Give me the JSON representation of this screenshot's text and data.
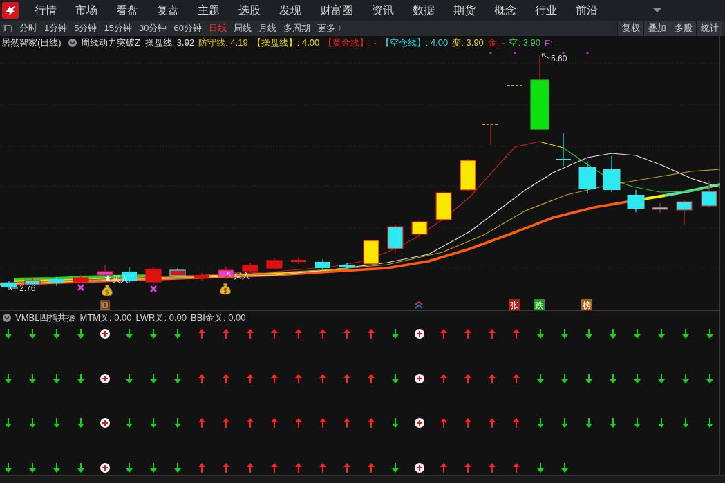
{
  "menu_bar": {
    "items": [
      "行情",
      "市场",
      "看盘",
      "复盘",
      "主题",
      "选股",
      "发现",
      "财富圈",
      "资讯",
      "数据",
      "期货",
      "概念",
      "行业",
      "前沿"
    ]
  },
  "period_bar": {
    "periods": [
      {
        "label": "分时",
        "selected": false
      },
      {
        "label": "1分钟",
        "selected": false
      },
      {
        "label": "5分钟",
        "selected": false
      },
      {
        "label": "15分钟",
        "selected": false
      },
      {
        "label": "30分钟",
        "selected": false
      },
      {
        "label": "60分钟",
        "selected": false
      },
      {
        "label": "日线",
        "selected": true
      },
      {
        "label": "周线",
        "selected": false
      },
      {
        "label": "月线",
        "selected": false
      },
      {
        "label": "多周期",
        "selected": false
      }
    ],
    "more": "更多 〉",
    "tools": [
      "复权",
      "叠加",
      "多股",
      "统计"
    ]
  },
  "price_chart": {
    "stock": "居然智家(日线)",
    "indicator": "周线动力突破Z",
    "legend": [
      {
        "label": "操盘线: 3.92",
        "color": "#e0e0e0"
      },
      {
        "label": "防守线: 4.19",
        "color": "#d8b820"
      },
      {
        "label": "【操盘线】: 4.00",
        "color": "#f0e020"
      },
      {
        "label": "【黄金线】: -",
        "color": "#e82020"
      },
      {
        "label": "【空仓线】: 4.00",
        "color": "#30d8e8"
      },
      {
        "label": "变: 3.90",
        "color": "#e8d020"
      },
      {
        "label": "金: -",
        "color": "#e82020"
      },
      {
        "label": "空: 3.90",
        "color": "#40c840"
      },
      {
        "label": "F: -",
        "color": "#c040e0"
      }
    ],
    "high_label": "5.60",
    "low_label": "2.76",
    "buy_labels": [
      "买入",
      "买入"
    ],
    "badges": [
      {
        "text": "张",
        "color": "#b41a1a"
      },
      {
        "text": "跌",
        "color": "#1f9a1f"
      },
      {
        "text": "榜",
        "color": "#a8621c"
      }
    ]
  },
  "indicator_panel": {
    "title": "VMBL四指共振",
    "values": [
      "MTM叉: 0.00",
      "LWR叉: 0.00",
      "BBI金叉: 0.00"
    ],
    "signal_rows": [
      [
        {
          "kind": "down"
        },
        {
          "kind": "down"
        },
        {
          "kind": "down"
        },
        {
          "kind": "down"
        },
        {
          "kind": "plus"
        },
        {
          "kind": "down"
        },
        {
          "kind": "down"
        },
        {
          "kind": "down"
        },
        {
          "kind": "up"
        },
        {
          "kind": "up"
        },
        {
          "kind": "up"
        },
        {
          "kind": "up"
        },
        {
          "kind": "up"
        },
        {
          "kind": "up"
        },
        {
          "kind": "up"
        },
        {
          "kind": "up"
        },
        {
          "kind": "down"
        },
        {
          "kind": "plus"
        },
        {
          "kind": "up"
        },
        {
          "kind": "up"
        },
        {
          "kind": "up"
        },
        {
          "kind": "up"
        },
        {
          "kind": "down"
        },
        {
          "kind": "down"
        },
        {
          "kind": "down"
        },
        {
          "kind": "down"
        },
        {
          "kind": "down"
        },
        {
          "kind": "down"
        },
        {
          "kind": "down"
        },
        {
          "kind": "down"
        }
      ],
      [
        {
          "kind": "down"
        },
        {
          "kind": "down"
        },
        {
          "kind": "down"
        },
        {
          "kind": "down"
        },
        {
          "kind": "plus"
        },
        {
          "kind": "down"
        },
        {
          "kind": "down"
        },
        {
          "kind": "down"
        },
        {
          "kind": "up"
        },
        {
          "kind": "up"
        },
        {
          "kind": "up"
        },
        {
          "kind": "up"
        },
        {
          "kind": "up"
        },
        {
          "kind": "up"
        },
        {
          "kind": "up"
        },
        {
          "kind": "up"
        },
        {
          "kind": "down"
        },
        {
          "kind": "plus"
        },
        {
          "kind": "up"
        },
        {
          "kind": "up"
        },
        {
          "kind": "up"
        },
        {
          "kind": "up"
        },
        {
          "kind": "down"
        },
        {
          "kind": "down"
        },
        {
          "kind": "down"
        },
        {
          "kind": "down"
        },
        {
          "kind": "down"
        },
        {
          "kind": "down"
        },
        {
          "kind": "down"
        },
        {
          "kind": "down"
        }
      ],
      [
        {
          "kind": "down"
        },
        {
          "kind": "down"
        },
        {
          "kind": "down"
        },
        {
          "kind": "down"
        },
        {
          "kind": "plus"
        },
        {
          "kind": "down"
        },
        {
          "kind": "down"
        },
        {
          "kind": "down"
        },
        {
          "kind": "up"
        },
        {
          "kind": "up"
        },
        {
          "kind": "up"
        },
        {
          "kind": "up"
        },
        {
          "kind": "up"
        },
        {
          "kind": "up"
        },
        {
          "kind": "up"
        },
        {
          "kind": "up"
        },
        {
          "kind": "down"
        },
        {
          "kind": "plus"
        },
        {
          "kind": "up"
        },
        {
          "kind": "up"
        },
        {
          "kind": "up"
        },
        {
          "kind": "up"
        },
        {
          "kind": "down"
        },
        {
          "kind": "down"
        },
        {
          "kind": "down"
        },
        {
          "kind": "down"
        },
        {
          "kind": "down"
        },
        {
          "kind": "down"
        },
        {
          "kind": "down"
        },
        {
          "kind": "down"
        }
      ],
      [
        {
          "kind": "down"
        },
        {
          "kind": "down"
        },
        {
          "kind": "down"
        },
        {
          "kind": "down"
        },
        {
          "kind": "plus"
        },
        {
          "kind": "down"
        },
        {
          "kind": "down"
        },
        {
          "kind": "down"
        },
        {
          "kind": "up"
        },
        {
          "kind": "up"
        },
        {
          "kind": "up"
        },
        {
          "kind": "up"
        },
        {
          "kind": "up"
        },
        {
          "kind": "up"
        },
        {
          "kind": "up"
        },
        {
          "kind": "up"
        },
        {
          "kind": "down"
        },
        {
          "kind": "plus"
        },
        {
          "kind": "up"
        },
        {
          "kind": "up"
        },
        {
          "kind": "up"
        },
        {
          "kind": "up"
        },
        {
          "kind": "down"
        },
        {
          "kind": "down"
        }
      ]
    ]
  }
}
